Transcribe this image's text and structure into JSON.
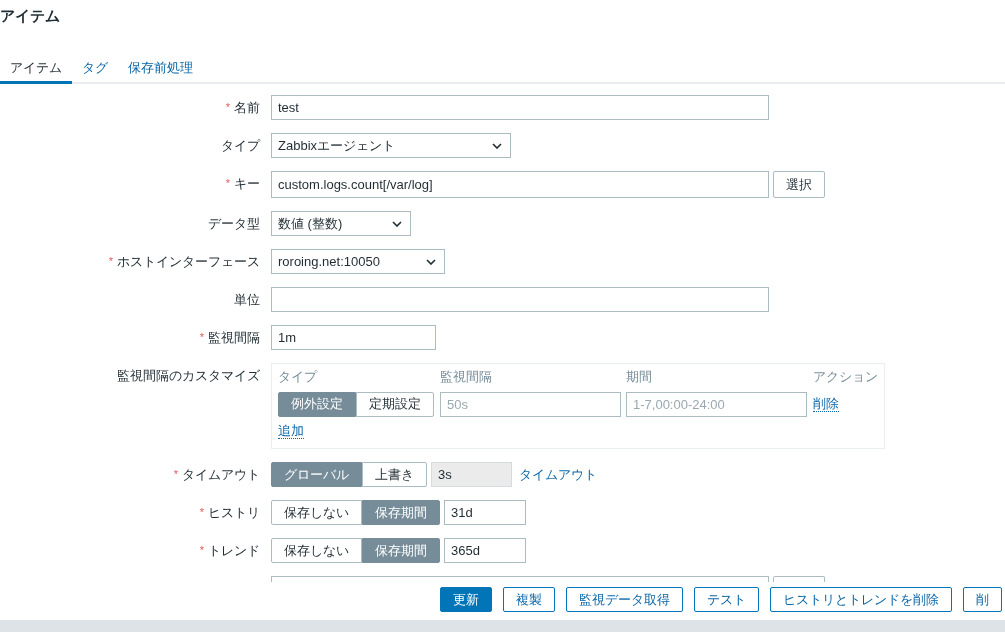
{
  "title": "アイテム",
  "tabs": [
    {
      "label": "アイテム",
      "selected": true
    },
    {
      "label": "タグ",
      "selected": false
    },
    {
      "label": "保存前処理",
      "selected": false
    }
  ],
  "fields": [
    {
      "kind": "text",
      "label": "名前",
      "required_mark": "*",
      "value": "test"
    },
    {
      "kind": "select",
      "label": "タイプ",
      "value": "Zabbixエージェント"
    },
    {
      "kind": "key",
      "label": "キー",
      "required_mark": "*",
      "value": "custom.logs.count[/var/log]",
      "button": "選択"
    },
    {
      "kind": "select",
      "label": "データ型",
      "value": "数値 (整数)"
    },
    {
      "kind": "select",
      "label": "ホストインターフェース",
      "required_mark": "*",
      "value": "roroing.net:10050"
    },
    {
      "kind": "text",
      "label": "単位"
    },
    {
      "kind": "text",
      "label": "監視間隔",
      "required_mark": "*",
      "value": "1m"
    },
    {
      "kind": "custom",
      "label": "監視間隔のカスタマイズ",
      "columns": [
        "タイプ",
        "監視間隔",
        "期間",
        "アクション"
      ],
      "rows": [
        {
          "options": [
            {
              "label": "例外設定",
              "selected": true
            },
            {
              "label": "定期設定",
              "selected": false
            }
          ],
          "interval_placeholder": "50s",
          "period_placeholder": "1-7,00:00-24:00",
          "action": "削除"
        }
      ],
      "add": "追加"
    },
    {
      "kind": "segmented",
      "label": "タイムアウト",
      "required_mark": "*",
      "options": [
        {
          "label": "グローバル",
          "selected": true
        },
        {
          "label": "上書き",
          "selected": false
        }
      ],
      "value": "3s",
      "disabled": true,
      "link": "タイムアウト"
    },
    {
      "kind": "segmented",
      "label": "ヒストリ",
      "required_mark": "*",
      "options": [
        {
          "label": "保存しない",
          "selected": false
        },
        {
          "label": "保存期間",
          "selected": true
        }
      ],
      "value": "31d",
      "disabled": false
    },
    {
      "kind": "segmented",
      "label": "トレンド",
      "required_mark": "*",
      "options": [
        {
          "label": "保存しない",
          "selected": false
        },
        {
          "label": "保存期間",
          "selected": true
        }
      ],
      "value": "365d",
      "disabled": false
    }
  ],
  "footer_buttons": [
    {
      "label": "更新",
      "primary": true
    },
    {
      "label": "複製",
      "primary": false
    },
    {
      "label": "監視データ取得",
      "primary": false
    },
    {
      "label": "テスト",
      "primary": false
    },
    {
      "label": "ヒストリとトレンドを削除",
      "primary": false
    },
    {
      "label": "削",
      "primary": false
    }
  ]
}
